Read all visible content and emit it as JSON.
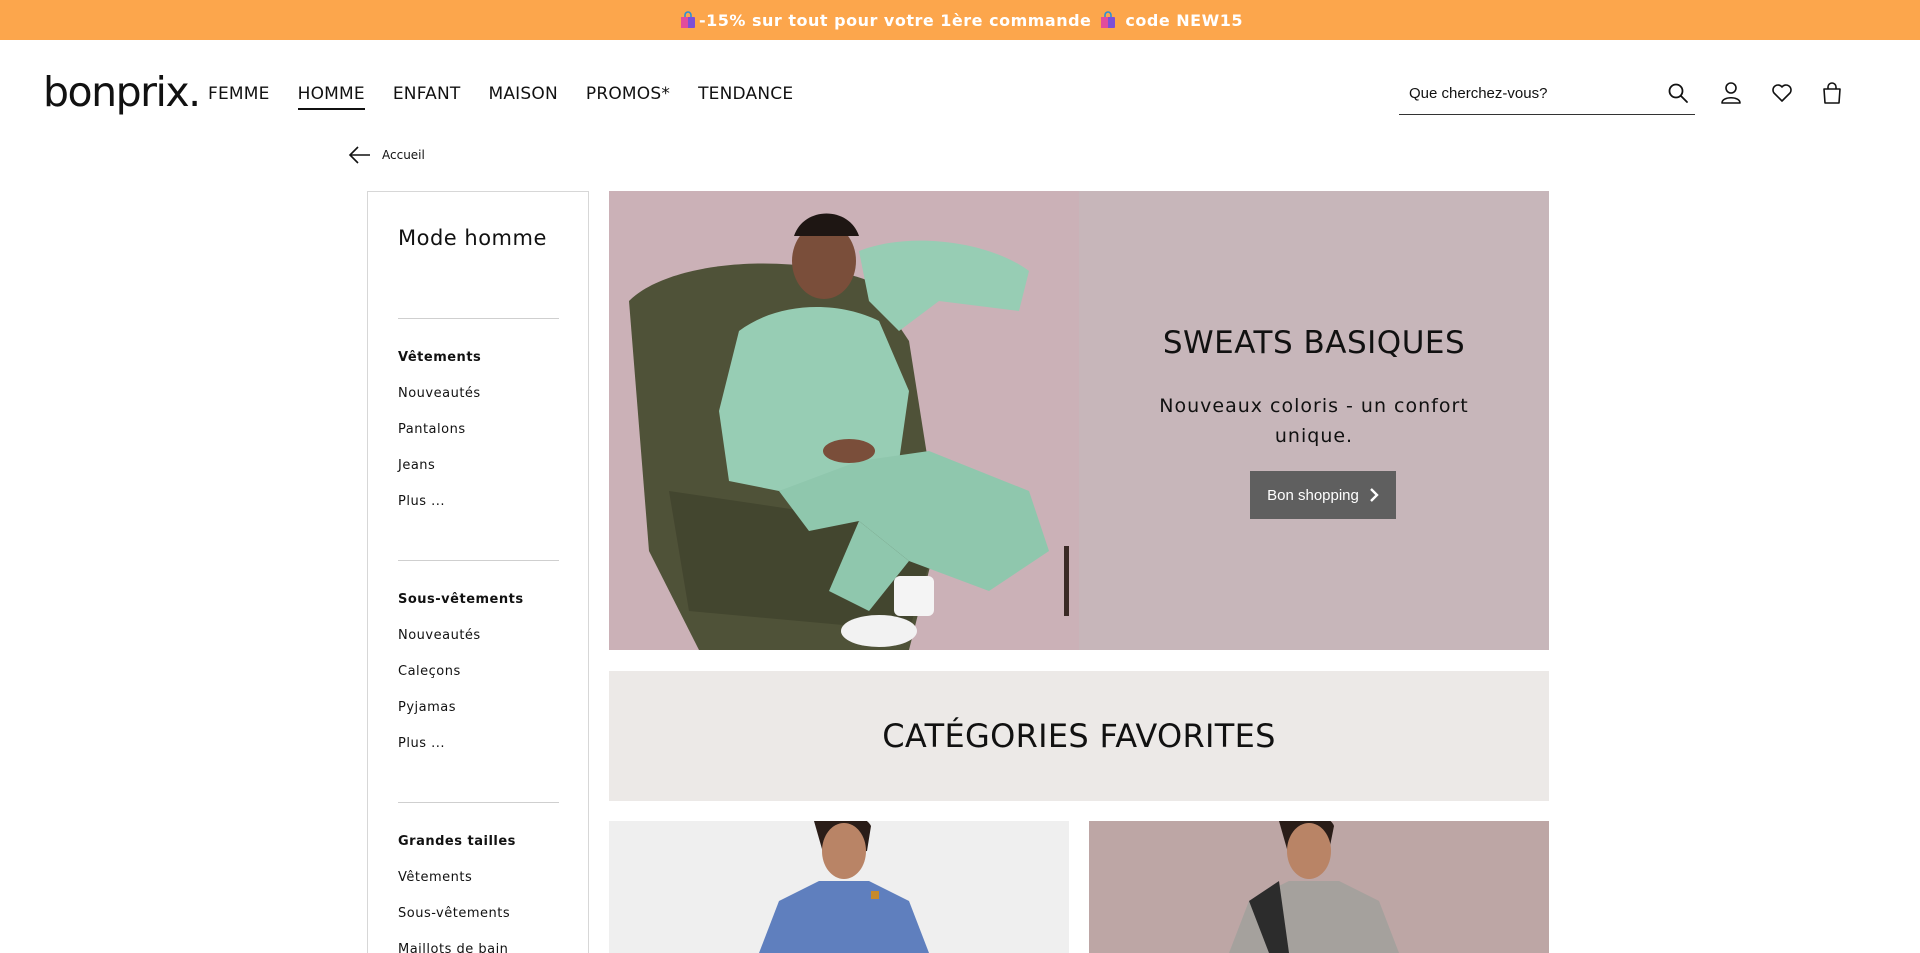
{
  "promo": {
    "text": "-15% sur tout pour votre 1ère commande",
    "code_text": "code NEW15"
  },
  "header": {
    "logo": "bonprix.",
    "nav": [
      {
        "label": "FEMME"
      },
      {
        "label": "HOMME",
        "active": true
      },
      {
        "label": "ENFANT"
      },
      {
        "label": "MAISON"
      },
      {
        "label": "PROMOS*"
      },
      {
        "label": "TENDANCE"
      }
    ],
    "search_placeholder": "Que cherchez-vous?",
    "icons": [
      "search-icon",
      "user-icon",
      "heart-icon",
      "shopping-bag-icon"
    ]
  },
  "breadcrumb": {
    "back_label": "Accueil"
  },
  "sidebar": {
    "title": "Mode homme",
    "groups": [
      {
        "title": "Vêtements",
        "items": [
          "Nouveautés",
          "Pantalons",
          "Jeans",
          "Plus ..."
        ]
      },
      {
        "title": "Sous-vêtements",
        "items": [
          "Nouveautés",
          "Caleçons",
          "Pyjamas",
          "Plus ..."
        ]
      },
      {
        "title": "Grandes tailles",
        "items": [
          "Vêtements",
          "Sous-vêtements",
          "Maillots de bain"
        ]
      }
    ]
  },
  "hero": {
    "title": "SWEATS BASIQUES",
    "subtitle": "Nouveaux coloris - un confort unique.",
    "button": "Bon shopping"
  },
  "categories": {
    "title": "CATÉGORIES FAVORITES"
  },
  "colors": {
    "promo_bg": "#fca64c",
    "hero_bg": "#c7b6ba",
    "button_bg": "#5f5f5f",
    "band_bg": "#ece9e7"
  }
}
